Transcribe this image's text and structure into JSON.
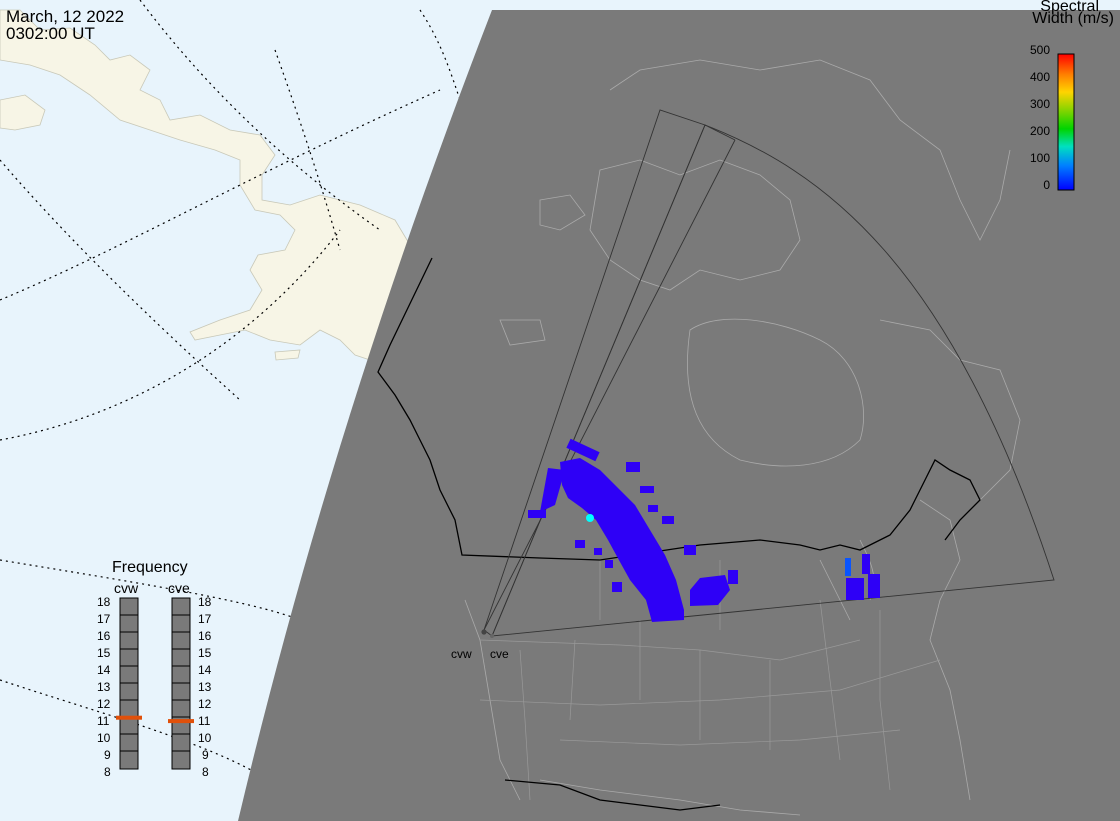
{
  "header": {
    "date": "March, 12 2022",
    "time": "0302:00 UT"
  },
  "colorbar": {
    "title_line1": "Spectral",
    "title_line2": "Width (m/s)",
    "ticks": [
      "500",
      "400",
      "300",
      "200",
      "100",
      "0"
    ],
    "colors": [
      "#ff0000",
      "#ff7f00",
      "#ffd400",
      "#7fd400",
      "#00d400",
      "#00e0c0",
      "#0080ff",
      "#0000ff"
    ]
  },
  "frequency_panel": {
    "title": "Frequency",
    "radars": [
      {
        "name": "cvw",
        "value_mhz": 11.0
      },
      {
        "name": "cve",
        "value_mhz": 10.8
      }
    ],
    "scale": [
      "18",
      "17",
      "16",
      "15",
      "14",
      "13",
      "12",
      "11",
      "10",
      "9",
      "8"
    ],
    "marker_color": "#e0500a"
  },
  "sites": [
    {
      "name": "cvw"
    },
    {
      "name": "cve"
    }
  ],
  "colors": {
    "ocean": "#e8f4fc",
    "land_day": "#f7f5e6",
    "night": "#7a7a7a",
    "scatter": "#2e00f6",
    "scatter_highlight": "#00ffff"
  }
}
